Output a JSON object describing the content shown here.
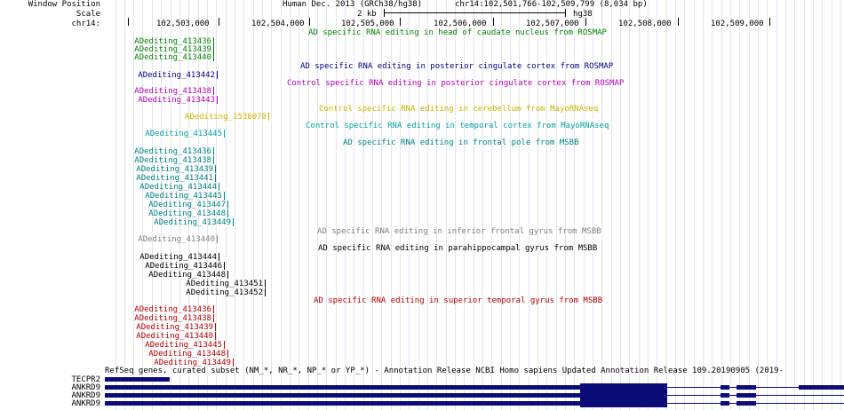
{
  "header": {
    "row_labels": [
      "Window Position",
      "Scale",
      "chr14:"
    ],
    "assembly": "Human Dec. 2013 (GRCh38/hg38)",
    "position": "chr14:102,501,766-102,509,799 (8,034 bp)",
    "scale_value": "2 kb",
    "scale_db": "hg38",
    "coordinates": [
      "102,503,000",
      "102,504,000",
      "102,505,000",
      "102,506,000",
      "102,507,000",
      "102,508,000",
      "102,509,000"
    ]
  },
  "tracks": [
    {
      "title": "AD specific RNA editing in head of caudate nucleus from ROSMAP",
      "color": "#008000",
      "items": [
        "ADediting_413436",
        "ADediting_413439",
        "ADediting_413440"
      ]
    },
    {
      "title": "AD specific RNA editing in posterior cingulate cortex from ROSMAP",
      "color": "#000080",
      "items": [
        "ADediting_413442"
      ]
    },
    {
      "title": "Control specific RNA editing in posterior cingulate cortex from ROSMAP",
      "color": "#b000b0",
      "items": [
        "ADediting_413438",
        "ADediting_413443"
      ]
    },
    {
      "title": "Control specific RNA editing in cerebellum from MayoRNAseq",
      "color": "#c8b400",
      "items": [
        "ADediting_1536070"
      ]
    },
    {
      "title": "Control specific RNA editing in temporal cortex from MayoRNAseq",
      "color": "#00a0a0",
      "items": [
        "ADediting_413445"
      ]
    },
    {
      "title": "AD specific RNA editing in frontal pole from MSBB",
      "color": "#008080",
      "items": [
        "ADediting_413436",
        "ADediting_413438",
        "ADediting_413439",
        "ADediting_413441",
        "ADediting_413444",
        "ADediting_413445",
        "ADediting_413447",
        "ADediting_413448",
        "ADediting_413449"
      ]
    },
    {
      "title": "AD specific RNA editing in inferior frontal gyrus from MSBB",
      "color": "#808080",
      "items": [
        "ADediting_413440"
      ]
    },
    {
      "title": "AD specific RNA editing in parahippocampal gyrus from MSBB",
      "color": "#000000",
      "items": [
        "ADediting_413444",
        "ADediting_413446",
        "ADediting_413448",
        "ADediting_413451",
        "ADediting_413452"
      ]
    },
    {
      "title": "AD specific RNA editing in superior temporal gyrus from MSBB",
      "color": "#b00000",
      "items": [
        "ADediting_413436",
        "ADediting_413438",
        "ADediting_413439",
        "ADediting_413440",
        "ADediting_413445",
        "ADediting_413448",
        "ADediting_413449"
      ]
    }
  ],
  "genes": {
    "title": "RefSeq genes, curated subset (NM_*, NR_*, NP_* or YP_*) - Annotation Release NCBI Homo sapiens Updated Annotation Release 109.20190905 (2019-",
    "color": "#0c0c78",
    "rows": [
      "TECPR2",
      "ANKRD9",
      "ANKRD9",
      "ANKRD9"
    ]
  }
}
